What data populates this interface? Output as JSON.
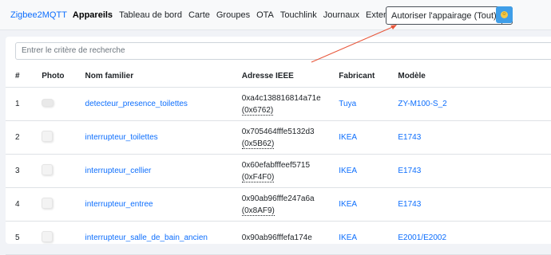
{
  "navbar": {
    "brand": "Zigbee2MQTT",
    "items": [
      "Appareils",
      "Tableau de bord",
      "Carte",
      "Groupes",
      "OTA",
      "Touchlink",
      "Journaux",
      "Extensions"
    ],
    "permit_join_label": "Autoriser l'appairage (Tout)"
  },
  "search": {
    "placeholder": "Entrer le critère de recherche"
  },
  "table": {
    "headers": [
      "#",
      "Photo",
      "Nom familier",
      "Adresse IEEE",
      "Fabricant",
      "Modèle"
    ],
    "rows": [
      {
        "num": "1",
        "name": "detecteur_presence_toilettes",
        "ieee": "0xa4c138816814a71e",
        "nwk": "(0x6762)",
        "maker": "Tuya",
        "model": "ZY-M100-S_2"
      },
      {
        "num": "2",
        "name": "interrupteur_toilettes",
        "ieee": "0x705464fffe5132d3",
        "nwk": "(0x5B62)",
        "maker": "IKEA",
        "model": "E1743"
      },
      {
        "num": "3",
        "name": "interrupteur_cellier",
        "ieee": "0x60efabfffeef5715",
        "nwk": "(0xF4F0)",
        "maker": "IKEA",
        "model": "E1743"
      },
      {
        "num": "4",
        "name": "interrupteur_entree",
        "ieee": "0x90ab96fffe247a6a",
        "nwk": "(0x8AF9)",
        "maker": "IKEA",
        "model": "E1743"
      },
      {
        "num": "5",
        "name": "interrupteur_salle_de_bain_ancien",
        "ieee": "0x90ab96fffefa174e",
        "nwk": "",
        "maker": "IKEA",
        "model": "E2001/E2002"
      }
    ]
  },
  "colors": {
    "link": "#0d6efd",
    "accent_button": "#3f9ee8",
    "annotation_arrow": "#e8563a"
  }
}
